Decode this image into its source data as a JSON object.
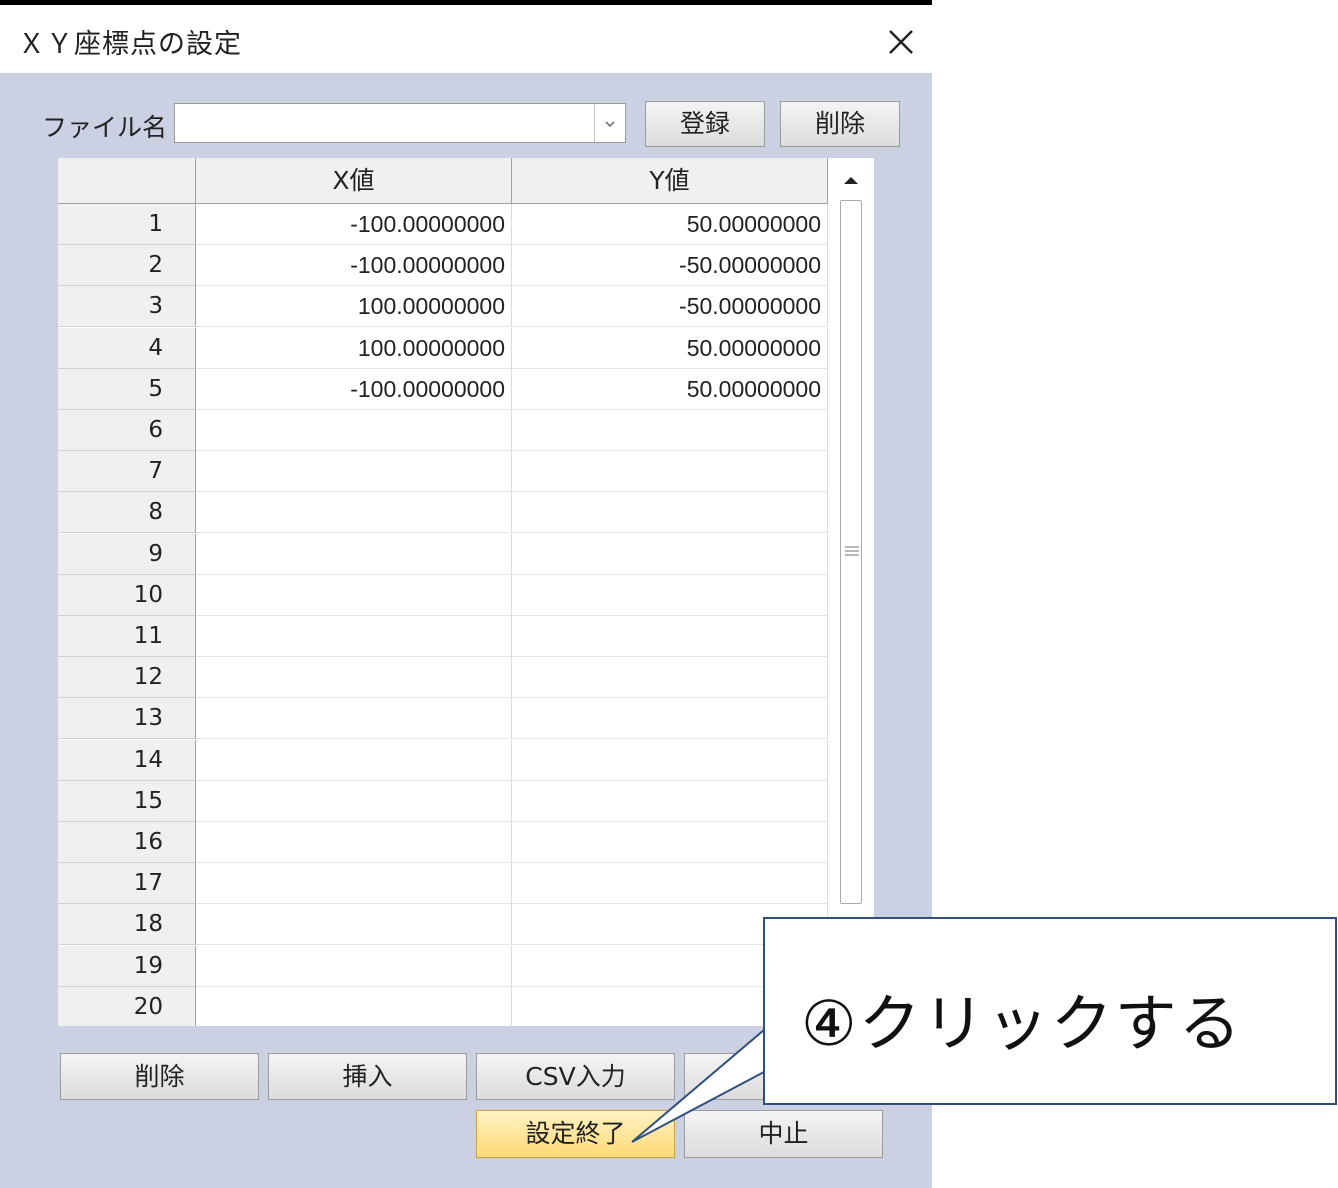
{
  "window": {
    "title": "ＸＹ座標点の設定",
    "close_glyph": "✕"
  },
  "file": {
    "label": "ファイル名",
    "value": "",
    "register_label": "登録",
    "delete_label": "削除"
  },
  "table": {
    "columns": [
      "X値",
      "Y値"
    ],
    "rows": [
      {
        "n": "1",
        "x": "-100.00000000",
        "y": "50.00000000"
      },
      {
        "n": "2",
        "x": "-100.00000000",
        "y": "-50.00000000"
      },
      {
        "n": "3",
        "x": "100.00000000",
        "y": "-50.00000000"
      },
      {
        "n": "4",
        "x": "100.00000000",
        "y": "50.00000000"
      },
      {
        "n": "5",
        "x": "-100.00000000",
        "y": "50.00000000"
      },
      {
        "n": "6",
        "x": "",
        "y": ""
      },
      {
        "n": "7",
        "x": "",
        "y": ""
      },
      {
        "n": "8",
        "x": "",
        "y": ""
      },
      {
        "n": "9",
        "x": "",
        "y": ""
      },
      {
        "n": "10",
        "x": "",
        "y": ""
      },
      {
        "n": "11",
        "x": "",
        "y": ""
      },
      {
        "n": "12",
        "x": "",
        "y": ""
      },
      {
        "n": "13",
        "x": "",
        "y": ""
      },
      {
        "n": "14",
        "x": "",
        "y": ""
      },
      {
        "n": "15",
        "x": "",
        "y": ""
      },
      {
        "n": "16",
        "x": "",
        "y": ""
      },
      {
        "n": "17",
        "x": "",
        "y": ""
      },
      {
        "n": "18",
        "x": "",
        "y": ""
      },
      {
        "n": "19",
        "x": "",
        "y": ""
      },
      {
        "n": "20",
        "x": "",
        "y": ""
      }
    ]
  },
  "buttons": {
    "row_delete": "削除",
    "insert": "挿入",
    "csv_input": "CSV入力",
    "finish": "設定終了",
    "cancel": "中止"
  },
  "callout": {
    "text": "④クリックする",
    "border_color": "#2f4f7f"
  },
  "colors": {
    "client_bg": "#ccd0e3",
    "primary_button": "#ffd978"
  }
}
